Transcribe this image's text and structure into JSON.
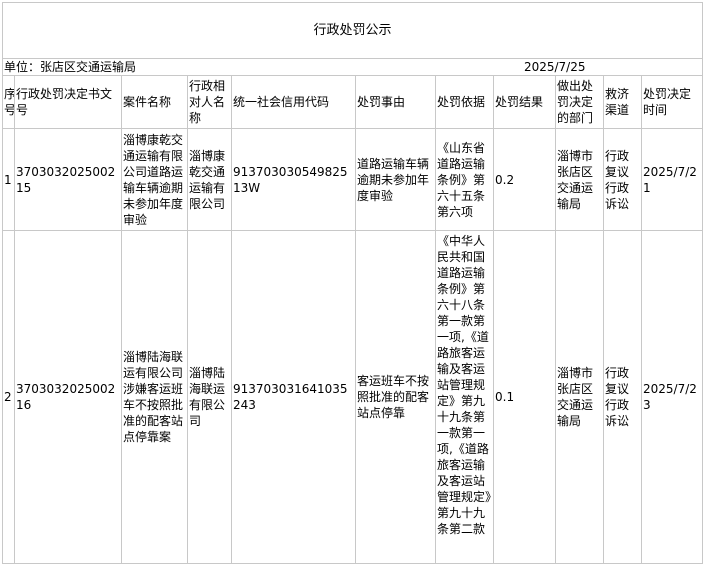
{
  "title": "行政处罚公示",
  "unit_label": "单位：张店区交通运输局",
  "date": "2025/7/25",
  "headers": [
    "序号",
    "行政处罚决定书文号",
    "案件名称",
    "行政相对人名称",
    "统一社会信用代码",
    "处罚事由",
    "处罚依据",
    "处罚结果",
    "做出处罚决定的部门",
    "救济渠道",
    "处罚决定时间"
  ],
  "rows": [
    {
      "seq": "1",
      "doc_no": "370303202500215",
      "case_name": "淄博康乾交通运输有限公司道路运输车辆逾期未参加年度审验",
      "party": "淄博康乾交通运输有限公司",
      "credit_code": "91370303054982513W",
      "reason": "道路运输车辆逾期未参加年度审验",
      "basis": "《山东省道路运输条例》第六十五条第六项",
      "result": "0.2",
      "dept": "淄博市张店区交通运输局",
      "remedy": "行政复议行政诉讼",
      "time": "2025/7/21"
    },
    {
      "seq": "2",
      "doc_no": "370303202500216",
      "case_name": "淄博陆海联运有限公司涉嫌客运班车不按照批准的配客站点停靠案",
      "party": "淄博陆海联运有限公司",
      "credit_code": "91370303164103524​3",
      "reason": "客运班车不按照批准的配客站点停靠",
      "basis": "《中华人民共和国道路运输条例》第六十八条第一款第一项,《道路旅客运输及客运站管理规定》第九十九条第一款第一项,《道路旅客运输及客运站管理规定》第九十九条第二款",
      "result": "0.1",
      "dept": "淄博市张店区交通运输局",
      "remedy": "行政复议行政诉讼",
      "time": "2025/7/23"
    }
  ]
}
